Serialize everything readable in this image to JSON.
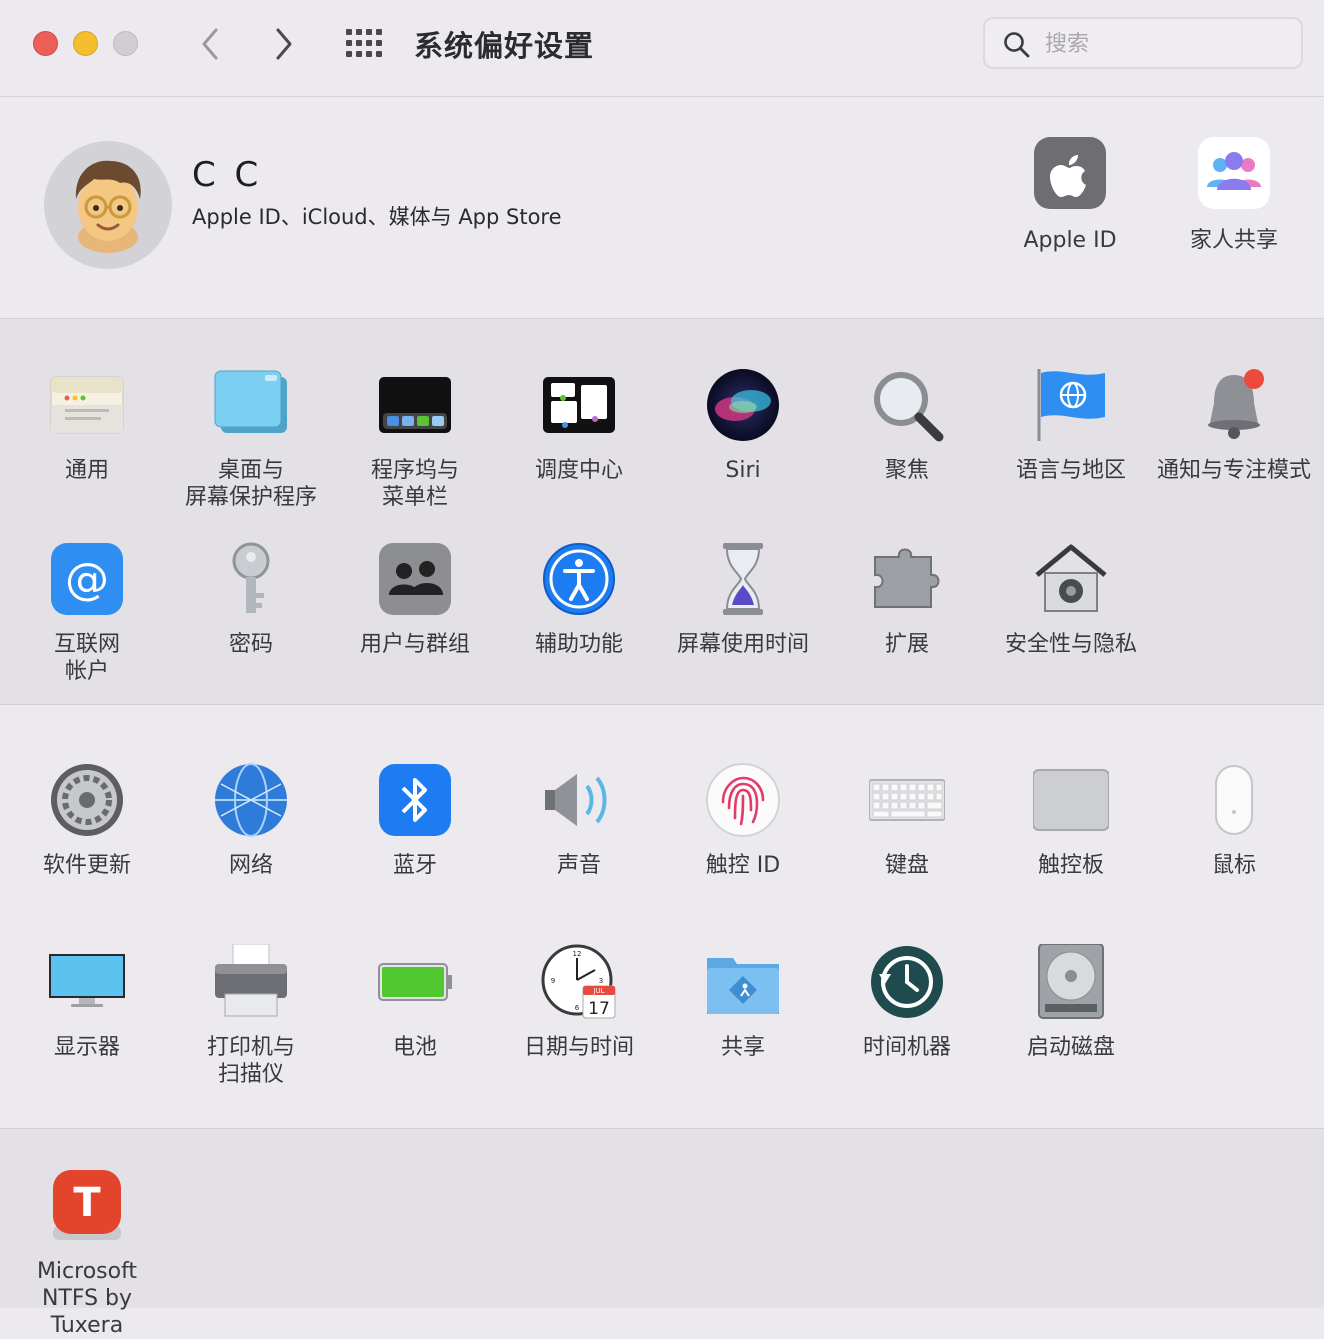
{
  "window": {
    "title": "系统偏好设置",
    "search_placeholder": "搜索"
  },
  "account": {
    "name": "C C",
    "subtitle": "Apple ID、iCloud、媒体与 App Store",
    "top_items": [
      {
        "label": "Apple ID",
        "icon": "apple-logo-icon"
      },
      {
        "label": "家人共享",
        "icon": "family-sharing-icon"
      }
    ]
  },
  "section1": [
    {
      "label": "通用",
      "icon": "general-icon"
    },
    {
      "label": "桌面与\n屏幕保护程序",
      "icon": "desktop-screensaver-icon"
    },
    {
      "label": "程序坞与\n菜单栏",
      "icon": "dock-menubar-icon"
    },
    {
      "label": "调度中心",
      "icon": "mission-control-icon"
    },
    {
      "label": "Siri",
      "icon": "siri-icon"
    },
    {
      "label": "聚焦",
      "icon": "spotlight-icon"
    },
    {
      "label": "语言与地区",
      "icon": "language-region-icon"
    },
    {
      "label": "通知与专注模式",
      "icon": "notifications-icon"
    },
    {
      "label": "互联网\n帐户",
      "icon": "internet-accounts-icon"
    },
    {
      "label": "密码",
      "icon": "key-icon"
    },
    {
      "label": "用户与群组",
      "icon": "users-groups-icon"
    },
    {
      "label": "辅助功能",
      "icon": "accessibility-icon"
    },
    {
      "label": "屏幕使用时间",
      "icon": "screen-time-icon"
    },
    {
      "label": "扩展",
      "icon": "extensions-icon"
    },
    {
      "label": "安全性与隐私",
      "icon": "security-privacy-icon"
    }
  ],
  "section2": [
    {
      "label": "软件更新",
      "icon": "software-update-icon"
    },
    {
      "label": "网络",
      "icon": "network-icon"
    },
    {
      "label": "蓝牙",
      "icon": "bluetooth-icon"
    },
    {
      "label": "声音",
      "icon": "sound-icon"
    },
    {
      "label": "触控 ID",
      "icon": "touch-id-icon"
    },
    {
      "label": "键盘",
      "icon": "keyboard-icon"
    },
    {
      "label": "触控板",
      "icon": "trackpad-icon"
    },
    {
      "label": "鼠标",
      "icon": "mouse-icon"
    },
    {
      "label": "显示器",
      "icon": "displays-icon"
    },
    {
      "label": "打印机与\n扫描仪",
      "icon": "printer-icon"
    },
    {
      "label": "电池",
      "icon": "battery-icon"
    },
    {
      "label": "日期与时间",
      "icon": "date-time-icon"
    },
    {
      "label": "共享",
      "icon": "sharing-icon"
    },
    {
      "label": "时间机器",
      "icon": "time-machine-icon"
    },
    {
      "label": "启动磁盘",
      "icon": "startup-disk-icon"
    }
  ],
  "section3": [
    {
      "label": "Microsoft\nNTFS by Tuxera",
      "icon": "tuxera-icon"
    }
  ],
  "calendar": {
    "month": "JUL",
    "day": "17"
  },
  "colors": {
    "accent": "#1E7CF2",
    "red_light": "#EC5F57",
    "yellow_light": "#F6BD2E"
  }
}
